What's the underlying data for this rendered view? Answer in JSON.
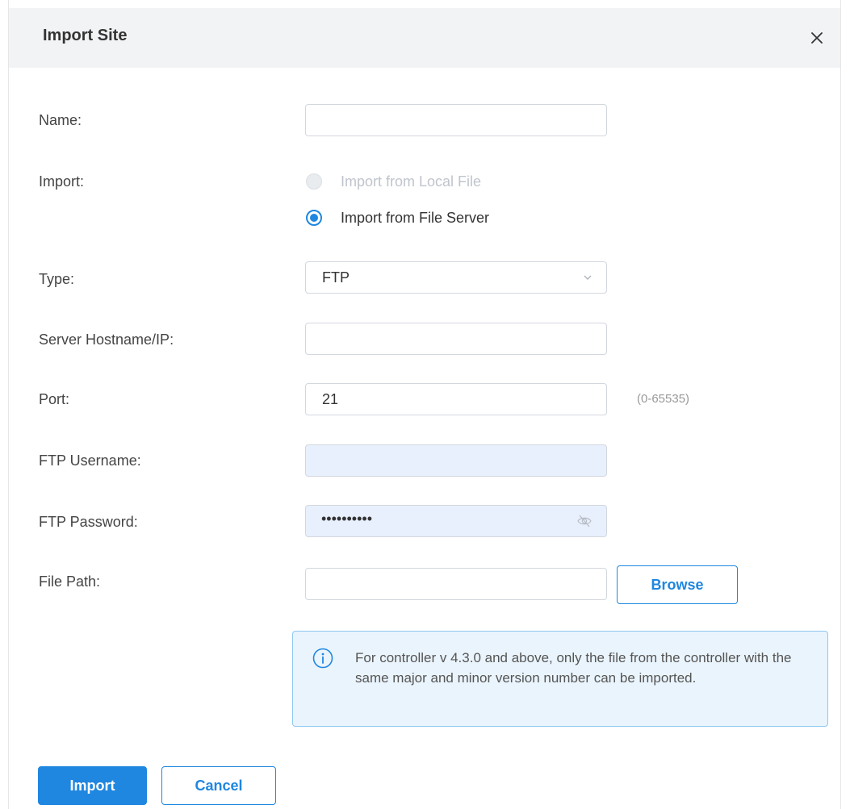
{
  "dialog": {
    "title": "Import Site",
    "close_icon": "close-icon"
  },
  "form": {
    "name": {
      "label": "Name",
      "value": "",
      "placeholder": ""
    },
    "import": {
      "label": "Import",
      "options": [
        {
          "label": "Import from Local File",
          "checked": false,
          "disabled": true
        },
        {
          "label": "Import from File Server",
          "checked": true,
          "disabled": false
        }
      ]
    },
    "type": {
      "label": "Type",
      "value": "FTP",
      "icon": "chevron-down-icon"
    },
    "server": {
      "label": "Server Hostname/IP",
      "value": ""
    },
    "port": {
      "label": "Port",
      "value": "21",
      "hint": "(0-65535)"
    },
    "ftp_username": {
      "label": "FTP Username",
      "value": ""
    },
    "ftp_password": {
      "label": "FTP Password",
      "masked": "••••••••••",
      "icon": "eye-off-icon"
    },
    "file_path": {
      "label": "File Path",
      "value": "",
      "browse_label": "Browse"
    }
  },
  "info": {
    "icon": "info-icon",
    "text": "For controller v 4.3.0 and above, only the file from the controller with the same major and minor version number can be imported."
  },
  "footer": {
    "import_label": "Import",
    "cancel_label": "Cancel"
  },
  "colors": {
    "accent": "#1f87e0",
    "header_bg": "#f2f3f5",
    "info_bg": "#eaf4fc",
    "autofill_bg": "#e8f0fe"
  }
}
